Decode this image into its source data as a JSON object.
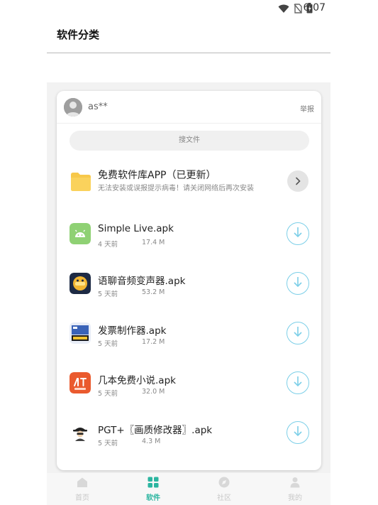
{
  "status": {
    "time": "6:07"
  },
  "header": {
    "title": "软件分类"
  },
  "card": {
    "username": "as**",
    "report": "举报",
    "search_placeholder": "搜文件",
    "folder": {
      "title": "免费软件库APP（已更新）",
      "desc": "无法安装或误报提示病毒！请关闭网络后再次安装"
    },
    "apps": [
      {
        "name": "Simple Live.apk",
        "age": "4 天前",
        "size": "17.4 M",
        "icon": "android-icon"
      },
      {
        "name": "语聊音频变声器.apk",
        "age": "5 天前",
        "size": "53.2 M",
        "icon": "voice-changer-icon"
      },
      {
        "name": "发票制作器.apk",
        "age": "5 天前",
        "size": "17.2 M",
        "icon": "invoice-icon"
      },
      {
        "name": "几本免费小说.apk",
        "age": "5 天前",
        "size": "32.0 M",
        "icon": "novel-icon"
      },
      {
        "name": "PGT+〖画质修改器〗.apk",
        "age": "5 天前",
        "size": "4.3 M",
        "icon": "spy-icon"
      }
    ]
  },
  "nav": {
    "items": [
      {
        "label": "首页",
        "icon": "home-icon"
      },
      {
        "label": "软件",
        "icon": "grid-icon"
      },
      {
        "label": "社区",
        "icon": "compass-icon"
      },
      {
        "label": "我的",
        "icon": "person-icon"
      }
    ],
    "active_color": "#2bb5a0"
  }
}
